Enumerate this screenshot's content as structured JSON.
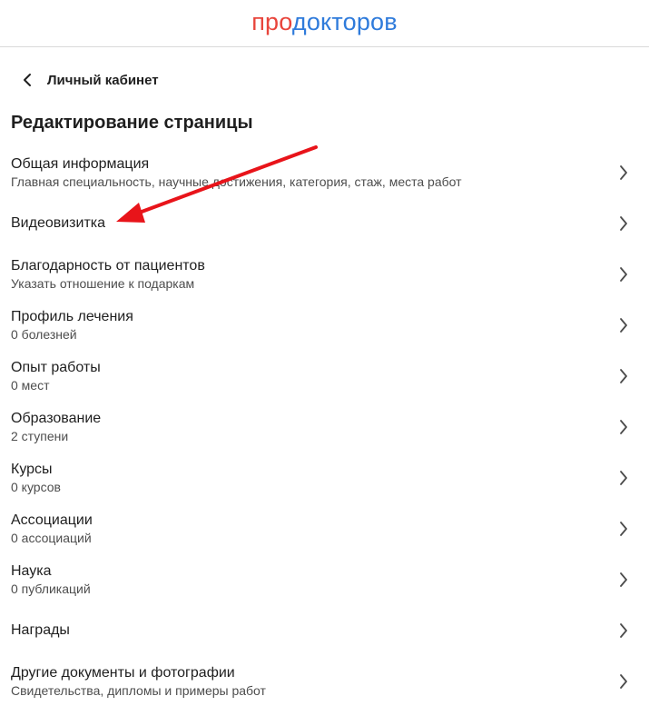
{
  "header": {
    "logo_part1": "про",
    "logo_part2": "докторов",
    "brand_red": "#e8453c",
    "brand_blue": "#2f7bdb"
  },
  "nav": {
    "back_label": "Личный кабинет"
  },
  "main": {
    "title": "Редактирование страницы",
    "items": [
      {
        "title": "Общая информация",
        "subtitle": "Главная специальность, научные достижения, категория, стаж, места работ"
      },
      {
        "title": "Видеовизитка",
        "subtitle": ""
      },
      {
        "title": "Благодарность от пациентов",
        "subtitle": "Указать отношение к подаркам"
      },
      {
        "title": "Профиль лечения",
        "subtitle": "0 болезней"
      },
      {
        "title": "Опыт работы",
        "subtitle": "0 мест"
      },
      {
        "title": "Образование",
        "subtitle": "2 ступени"
      },
      {
        "title": "Курсы",
        "subtitle": "0 курсов"
      },
      {
        "title": "Ассоциации",
        "subtitle": "0 ассоциаций"
      },
      {
        "title": "Наука",
        "subtitle": "0 публикаций"
      },
      {
        "title": "Награды",
        "subtitle": ""
      },
      {
        "title": "Другие документы и фотографии",
        "subtitle": "Свидетельства, дипломы и примеры работ"
      }
    ]
  },
  "annotation": {
    "arrow_color": "#e8141a"
  }
}
